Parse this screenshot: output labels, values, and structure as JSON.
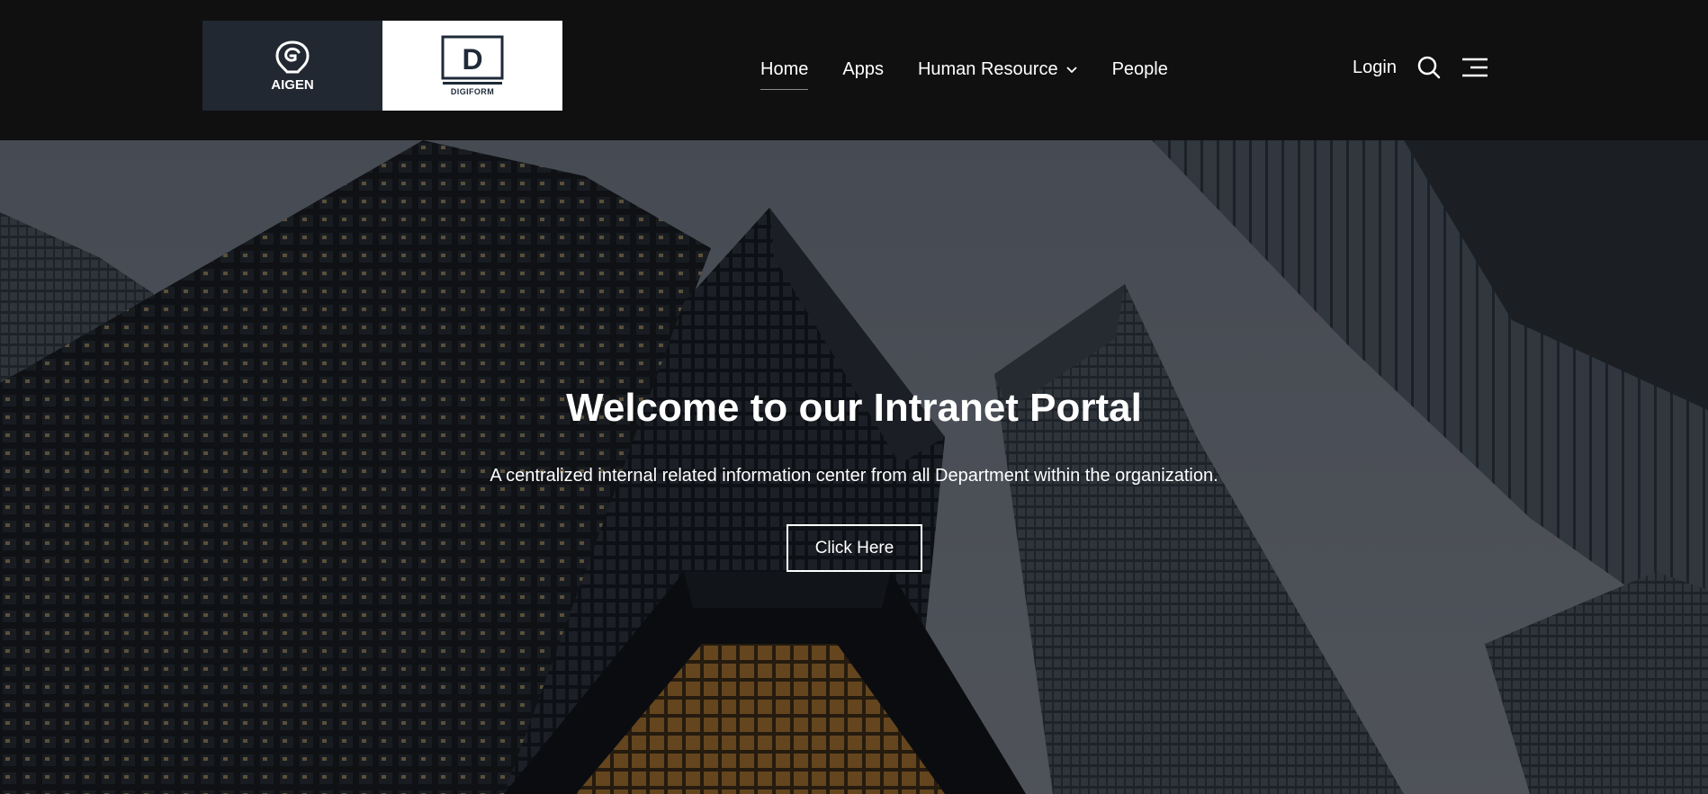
{
  "header": {
    "logos": [
      {
        "name": "AIGEN",
        "text": "AIGEN"
      },
      {
        "name": "DIGIFORM",
        "text": "DIGIFORM"
      }
    ],
    "nav": [
      {
        "label": "Home",
        "active": true
      },
      {
        "label": "Apps",
        "active": false
      },
      {
        "label": "Human Resource",
        "active": false,
        "has_dropdown": true
      },
      {
        "label": "People",
        "active": false
      }
    ],
    "login_label": "Login",
    "icons": [
      "search-icon",
      "menu-icon",
      "chevron-down-icon"
    ]
  },
  "hero": {
    "title": "Welcome to our Intranet Portal",
    "subtitle": "A centralized internal related information center from all Department within the organization.",
    "button_label": "Click Here"
  },
  "colors": {
    "header_bg": "#101010",
    "aigen_logo_bg": "#222831",
    "digiform_logo_bg": "#ffffff",
    "text": "#ffffff"
  }
}
